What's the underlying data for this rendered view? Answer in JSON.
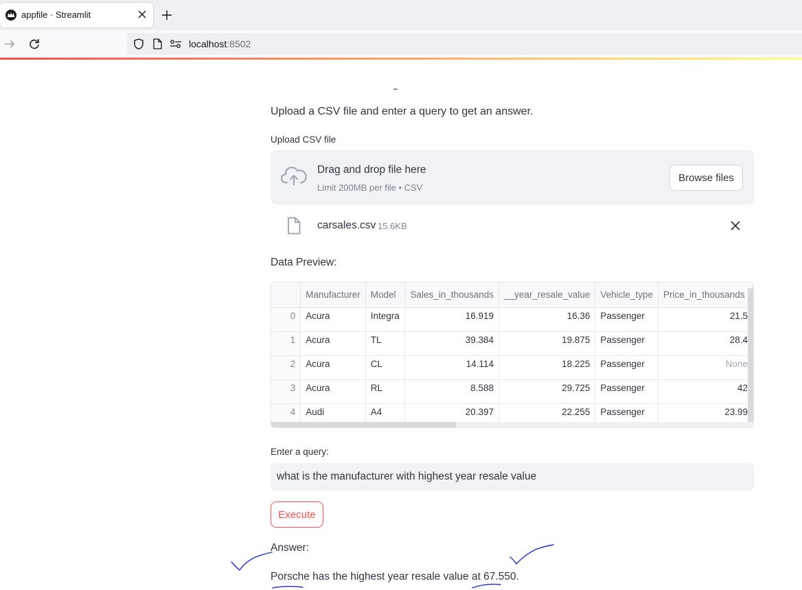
{
  "browser": {
    "tab_title": "appfile · Streamlit",
    "url_host": "localhost",
    "url_port": ":8502"
  },
  "app": {
    "intro": "Upload a CSV file and enter a query to get an answer.",
    "uploader": {
      "label": "Upload CSV file",
      "drop_title": "Drag and drop file here",
      "limit": "Limit 200MB per file • CSV",
      "browse_label": "Browse files"
    },
    "file": {
      "name": "carsales.csv",
      "size": "15.6KB"
    },
    "preview_label": "Data Preview:",
    "table": {
      "columns": [
        "Manufacturer",
        "Model",
        "Sales_in_thousands",
        "__year_resale_value",
        "Vehicle_type",
        "Price_in_thousands"
      ],
      "rows": [
        [
          "0",
          "Acura",
          "Integra",
          "16.919",
          "16.36",
          "Passenger",
          "21.5"
        ],
        [
          "1",
          "Acura",
          "TL",
          "39.384",
          "19.875",
          "Passenger",
          "28.4"
        ],
        [
          "2",
          "Acura",
          "CL",
          "14.114",
          "18.225",
          "Passenger",
          "None"
        ],
        [
          "3",
          "Acura",
          "RL",
          "8.588",
          "29.725",
          "Passenger",
          "42"
        ],
        [
          "4",
          "Audi",
          "A4",
          "20.397",
          "22.255",
          "Passenger",
          "23.99"
        ]
      ]
    },
    "query": {
      "label": "Enter a query:",
      "value": "what is the manufacturer with highest year resale value"
    },
    "execute_label": "Execute",
    "answer_label": "Answer:",
    "answer_text": "Porsche has the highest year resale value at 67.550."
  },
  "colors": {
    "accent": "#ff4b4b",
    "text": "#31333f",
    "secondary_bg": "#f0f2f6",
    "annotation_ink": "#1a2fd0"
  },
  "icons": [
    "streamlit-favicon-icon",
    "close-icon",
    "plus-icon",
    "forward-arrow-icon",
    "reload-icon",
    "shield-icon",
    "page-icon",
    "permissions-icon",
    "cloud-upload-icon",
    "file-icon",
    "close-x-icon"
  ]
}
